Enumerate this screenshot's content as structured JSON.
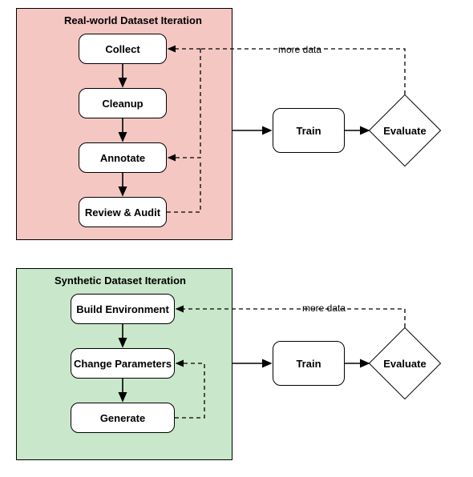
{
  "real": {
    "title": "Real-world Dataset Iteration",
    "steps": [
      "Collect",
      "Cleanup",
      "Annotate",
      "Review & Audit"
    ],
    "train": "Train",
    "evaluate": "Evaluate",
    "more_data": "more data"
  },
  "syn": {
    "title": "Synthetic Dataset Iteration",
    "steps": [
      "Build Environment",
      "Change Parameters",
      "Generate"
    ],
    "train": "Train",
    "evaluate": "Evaluate",
    "more_data": "more data"
  }
}
